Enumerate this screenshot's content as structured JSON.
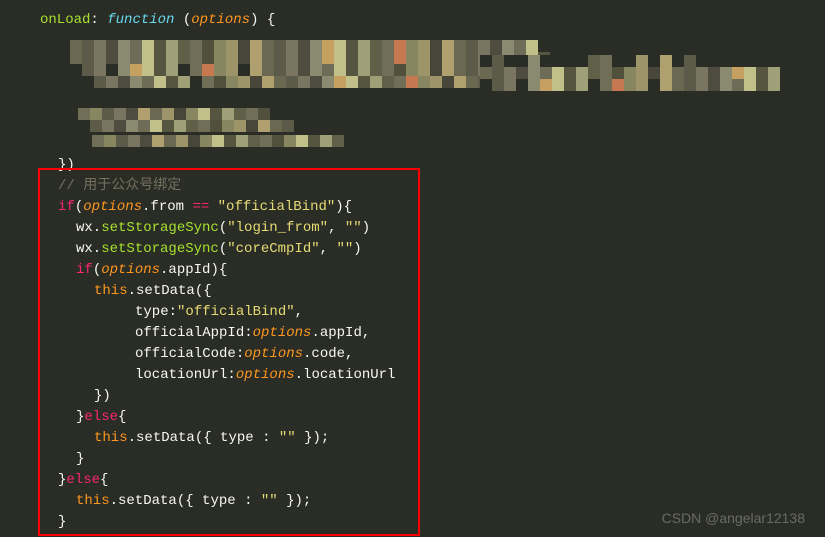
{
  "code": {
    "onLoad": "onLoad",
    "function": "function",
    "options": "options",
    "closeParen1": "})",
    "comment1": "// 用于公众号绑定",
    "if": "if",
    "from": ".from",
    "eq": " == ",
    "officialBind": "\"officialBind\"",
    "wx": "wx.",
    "setStorageSync": "setStorageSync",
    "login_from": "\"login_from\"",
    "empty": "\"\"",
    "coreCmpId": "\"coreCmpId\"",
    "appId": ".appId",
    "this": "this",
    "setData": ".setData",
    "typeKey": "type:",
    "officialAppIdKey": "officialAppId:",
    "officialCodeKey": "officialCode:",
    "locationUrlKey": "locationUrl:",
    "appIdProp": ".appId",
    "codeProp": ".code",
    "locationUrlProp": ".locationUrl",
    "else": "else",
    "typeSpace": " type ",
    "colon": ": ",
    "openBrace": "{",
    "closeBrace": "}",
    "openParen": "(",
    "closeParen": ")",
    "comma": ", ",
    "commaTrail": ",",
    "semi": ";",
    "openObjParen": "({",
    "closeObjParen": "})"
  },
  "watermark": "CSDN @angelar12138"
}
